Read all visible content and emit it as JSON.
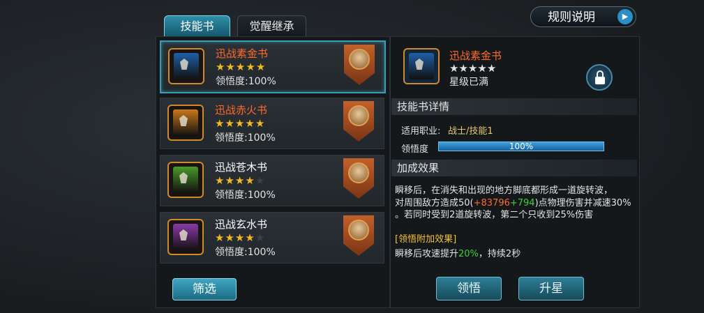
{
  "tabs": [
    {
      "label": "技能书",
      "active": true
    },
    {
      "label": "觉醒继承",
      "active": false
    }
  ],
  "rules_button": "规则说明",
  "books": [
    {
      "name": "迅战素金书",
      "name_color": "#ff6a2a",
      "stars": 5,
      "max_stars": 5,
      "comprehension": "领悟度:100%",
      "book_color": "#1f5fa8",
      "frame_color": "#d08a2a",
      "selected": true
    },
    {
      "name": "迅战赤火书",
      "name_color": "#ff6a2a",
      "stars": 5,
      "max_stars": 5,
      "comprehension": "领悟度:100%",
      "book_color": "#c8781a",
      "frame_color": "#d08a2a",
      "selected": false
    },
    {
      "name": "迅战苍木书",
      "name_color": "#ffffff",
      "stars": 4,
      "max_stars": 5,
      "comprehension": "领悟度:100%",
      "book_color": "#4a9a2a",
      "frame_color": "#d08a2a",
      "selected": false
    },
    {
      "name": "迅战玄水书",
      "name_color": "#ffffff",
      "stars": 4,
      "max_stars": 5,
      "comprehension": "领悟度:100%",
      "book_color": "#8a3aa8",
      "frame_color": "#d08a2a",
      "selected": false
    }
  ],
  "filter_button": "筛选",
  "detail": {
    "name": "迅战素金书",
    "stars": 5,
    "star_status": "星级已满",
    "section_details": "技能书详情",
    "job_label": "适用职业:",
    "job_value": "战士/技能1",
    "comprehension_label": "领悟度",
    "comprehension_value": "100%",
    "comprehension_fraction": 1.0,
    "section_bonus": "加成效果",
    "bonus_line1": "瞬移后，在消失和出现的地方脚底都形成一道旋转波，",
    "bonus_line2_a": "对周围敌方造成50(",
    "bonus_line2_b": "+83796",
    "bonus_line2_c": "+794",
    "bonus_line2_d": ")点物理伤害并减速30%",
    "bonus_line3": "。若同时受到2道旋转波，第二个只收到25%伤害",
    "extra_title": "[领悟附加效果]",
    "extra_a": "瞬移后攻速提升",
    "extra_b": "20%",
    "extra_c": "，持续2秒"
  },
  "buttons": {
    "comprehend": "领悟",
    "upgrade": "升星"
  },
  "colors": {
    "accent_orange": "#ff6a2a",
    "accent_green": "#3cd23c",
    "extra_title": "#f2c23a",
    "detail_label": "#e6c870"
  }
}
